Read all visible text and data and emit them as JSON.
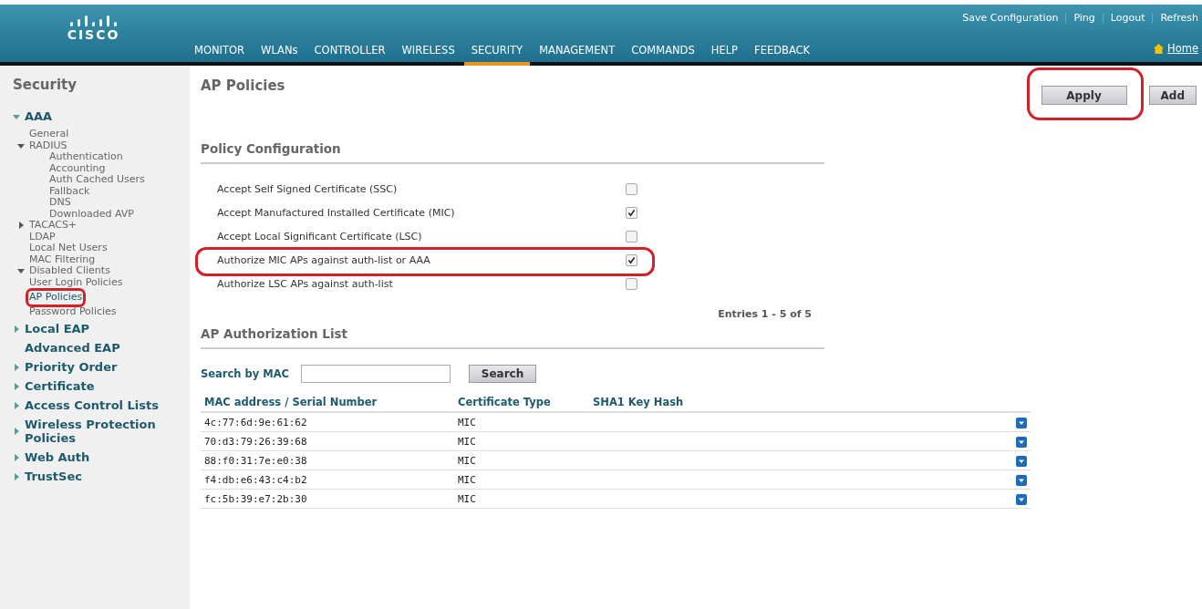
{
  "header": {
    "logo": "CISCO",
    "links": [
      "Save Configuration",
      "Ping",
      "Logout",
      "Refresh"
    ],
    "home": "Home",
    "nav": [
      {
        "label": "MONITOR",
        "selected": false
      },
      {
        "label": "WLANs",
        "selected": false
      },
      {
        "label": "CONTROLLER",
        "selected": false
      },
      {
        "label": "WIRELESS",
        "selected": false
      },
      {
        "label": "SECURITY",
        "selected": true
      },
      {
        "label": "MANAGEMENT",
        "selected": false
      },
      {
        "label": "COMMANDS",
        "selected": false
      },
      {
        "label": "HELP",
        "selected": false
      },
      {
        "label": "FEEDBACK",
        "selected": false
      }
    ]
  },
  "sidebar": {
    "title": "Security",
    "items": [
      {
        "label": "AAA",
        "kind": "folder",
        "expanded": true,
        "selected": false,
        "children": [
          {
            "label": "General",
            "kind": "leaf",
            "selected": false
          },
          {
            "label": "RADIUS",
            "kind": "folder",
            "expanded": true,
            "selected": false,
            "children": [
              {
                "label": "Authentication",
                "selected": false
              },
              {
                "label": "Accounting",
                "selected": false
              },
              {
                "label": "Auth Cached Users",
                "selected": false
              },
              {
                "label": "Fallback",
                "selected": false
              },
              {
                "label": "DNS",
                "selected": false
              },
              {
                "label": "Downloaded AVP",
                "selected": false
              }
            ]
          },
          {
            "label": "TACACS+",
            "kind": "folder",
            "expanded": false,
            "selected": false
          },
          {
            "label": "LDAP",
            "kind": "leaf",
            "selected": false
          },
          {
            "label": "Local Net Users",
            "kind": "leaf",
            "selected": false
          },
          {
            "label": "MAC Filtering",
            "kind": "leaf",
            "selected": false
          },
          {
            "label": "Disabled Clients",
            "kind": "folder",
            "expanded": true,
            "selected": false
          },
          {
            "label": "User Login Policies",
            "kind": "leaf",
            "selected": false
          },
          {
            "label": "AP Policies",
            "kind": "leaf",
            "selected": true
          },
          {
            "label": "Password Policies",
            "kind": "leaf",
            "selected": false
          }
        ]
      },
      {
        "label": "Local EAP",
        "kind": "folder",
        "expanded": false,
        "selected": false
      },
      {
        "label": "Advanced EAP",
        "kind": "leaf",
        "selected": false
      },
      {
        "label": "Priority Order",
        "kind": "folder",
        "expanded": false,
        "selected": false
      },
      {
        "label": "Certificate",
        "kind": "folder",
        "expanded": false,
        "selected": false
      },
      {
        "label": "Access Control Lists",
        "kind": "folder",
        "expanded": false,
        "selected": false
      },
      {
        "label": "Wireless Protection Policies",
        "kind": "folder",
        "expanded": false,
        "selected": false
      },
      {
        "label": "Web Auth",
        "kind": "folder",
        "expanded": false,
        "selected": false
      },
      {
        "label": "TrustSec",
        "kind": "folder",
        "expanded": false,
        "selected": false
      }
    ]
  },
  "page": {
    "title": "AP Policies",
    "buttons": [
      "Apply",
      "Add"
    ],
    "policy": {
      "title": "Policy Configuration",
      "options": [
        {
          "label": "Accept Self Signed Certificate (SSC)",
          "checked": false
        },
        {
          "label": "Accept Manufactured Installed Certificate (MIC)",
          "checked": true
        },
        {
          "label": "Accept Local Significant Certificate (LSC)",
          "checked": false
        },
        {
          "label": "Authorize MIC APs against auth-list or AAA",
          "checked": true
        },
        {
          "label": "Authorize LSC APs against auth-list",
          "checked": false
        }
      ]
    },
    "list": {
      "title": "AP Authorization List",
      "entries": "Entries 1 - 5 of 5",
      "search_label": "Search by MAC",
      "search_button": "Search",
      "columns": [
        "MAC address / Serial Number",
        "Certificate Type",
        "SHA1 Key Hash"
      ],
      "rows": [
        {
          "mac": "4c:77:6d:9e:61:62",
          "type": "MIC"
        },
        {
          "mac": "70:d3:79:26:39:68",
          "type": "MIC"
        },
        {
          "mac": "88:f0:31:7e:e0:38",
          "type": "MIC"
        },
        {
          "mac": "f4:db:e6:43:c4:b2",
          "type": "MIC"
        },
        {
          "mac": "fc:5b:39:e7:2b:30",
          "type": "MIC"
        }
      ]
    }
  }
}
